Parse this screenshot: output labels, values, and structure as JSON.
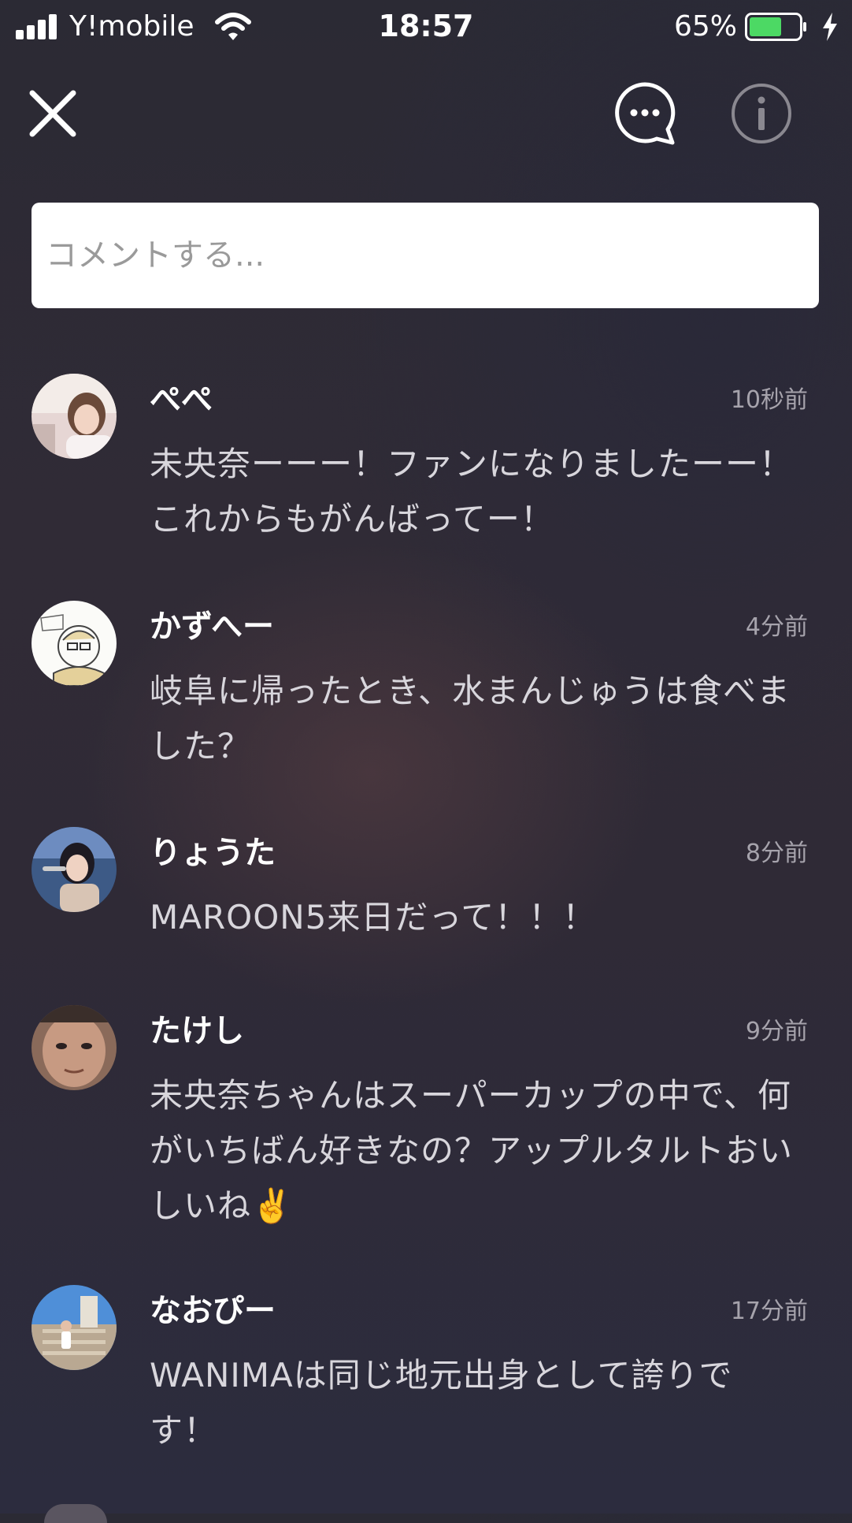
{
  "status_bar": {
    "carrier": "Y!mobile",
    "time": "18:57",
    "battery_percent": "65%",
    "battery_level": 0.65,
    "signal_icon": "signal-bars-icon",
    "wifi_icon": "wifi-icon",
    "battery_color": "#4cd964"
  },
  "nav": {
    "close_icon": "close-icon",
    "comments_icon": "speech-bubble-icon",
    "info_icon": "info-icon"
  },
  "comment_input": {
    "placeholder": "コメントする..."
  },
  "comments": [
    {
      "name": "ぺぺ",
      "time": "10秒前",
      "text": "未央奈ーーー！ファンになりましたーー！これからもがんばってー！"
    },
    {
      "name": "かずへー",
      "time": "4分前",
      "text": "岐阜に帰ったとき、水まんじゅうは食べました？"
    },
    {
      "name": "りょうた",
      "time": "8分前",
      "text": "MAROON5来日だって！！！"
    },
    {
      "name": "たけし",
      "time": "9分前",
      "text": "未央奈ちゃんはスーパーカップの中で、何がいちばん好きなの？アップルタルトおいしいね",
      "emoji": "✌️"
    },
    {
      "name": "なおぴー",
      "time": "17分前",
      "text": "WANIMAは同じ地元出身として誇りです！"
    }
  ]
}
